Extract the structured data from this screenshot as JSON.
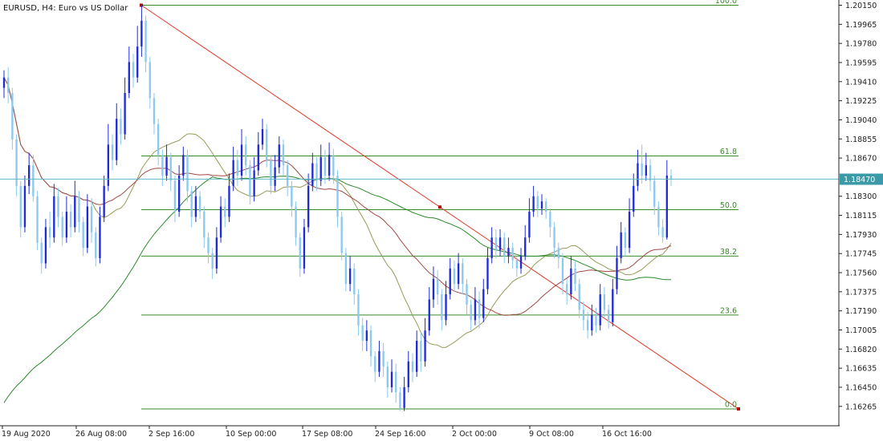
{
  "symbol_header": "EURUSD, H4:  Euro vs US Dollar",
  "current_price": "1.18470",
  "colors": {
    "background": "#ffffff",
    "bull_candle": "#1f2bd6",
    "bear_candle": "#8cc8f0",
    "fibo": "#3a8a2a",
    "trend_line": "#e03a2a",
    "ma_fast": "#9a9a56",
    "ma_mid": "#a04a44",
    "ma_slow": "#2a8a2a",
    "bid_line": "#5fb8c8",
    "axis": "#222222"
  },
  "price_axis": {
    "labels": [
      "1.20150",
      "1.19965",
      "1.19780",
      "1.19595",
      "1.19410",
      "1.19225",
      "1.19040",
      "1.18855",
      "1.18670",
      "1.18300",
      "1.18115",
      "1.17930",
      "1.17745",
      "1.17560",
      "1.17375",
      "1.17190",
      "1.17005",
      "1.16820",
      "1.16635",
      "1.16450",
      "1.16265"
    ]
  },
  "time_axis": {
    "labels": [
      "19 Aug 2020",
      "26 Aug 08:00",
      "2 Sep 16:00",
      "10 Sep 00:00",
      "17 Sep 08:00",
      "24 Sep 16:00",
      "2 Oct 00:00",
      "9 Oct 08:00",
      "16 Oct 16:00"
    ]
  },
  "fibonacci": {
    "levels": [
      {
        "label": "100.0",
        "price": 1.2015
      },
      {
        "label": "61.8",
        "price": 1.1869
      },
      {
        "label": "50.0",
        "price": 1.1817
      },
      {
        "label": "38.2",
        "price": 1.1772
      },
      {
        "label": "23.6",
        "price": 1.1715
      },
      {
        "label": "0.0",
        "price": 1.1624
      }
    ]
  },
  "chart_data": {
    "type": "candlestick",
    "symbol": "EURUSD",
    "timeframe": "H4",
    "ylim": [
      1.1621,
      1.2018
    ],
    "candles": [
      {
        "o": 1.1935,
        "c": 1.1945,
        "h": 1.1952,
        "l": 1.1925
      },
      {
        "o": 1.1945,
        "c": 1.193,
        "h": 1.1955,
        "l": 1.192
      },
      {
        "o": 1.193,
        "c": 1.1885,
        "h": 1.1935,
        "l": 1.1875
      },
      {
        "o": 1.1885,
        "c": 1.184,
        "h": 1.189,
        "l": 1.183
      },
      {
        "o": 1.184,
        "c": 1.18,
        "h": 1.1845,
        "l": 1.179
      },
      {
        "o": 1.18,
        "c": 1.184,
        "h": 1.185,
        "l": 1.1795
      },
      {
        "o": 1.184,
        "c": 1.186,
        "h": 1.1872,
        "l": 1.1832
      },
      {
        "o": 1.186,
        "c": 1.183,
        "h": 1.187,
        "l": 1.1825
      },
      {
        "o": 1.183,
        "c": 1.1785,
        "h": 1.1835,
        "l": 1.1778
      },
      {
        "o": 1.1785,
        "c": 1.1765,
        "h": 1.179,
        "l": 1.1755
      },
      {
        "o": 1.1765,
        "c": 1.18,
        "h": 1.1808,
        "l": 1.176
      },
      {
        "o": 1.18,
        "c": 1.179,
        "h": 1.1815,
        "l": 1.178
      },
      {
        "o": 1.179,
        "c": 1.183,
        "h": 1.1842,
        "l": 1.1785
      },
      {
        "o": 1.183,
        "c": 1.181,
        "h": 1.1838,
        "l": 1.18
      },
      {
        "o": 1.181,
        "c": 1.179,
        "h": 1.1815,
        "l": 1.1782
      },
      {
        "o": 1.179,
        "c": 1.1815,
        "h": 1.183,
        "l": 1.1785
      },
      {
        "o": 1.1815,
        "c": 1.18,
        "h": 1.1822,
        "l": 1.179
      },
      {
        "o": 1.18,
        "c": 1.183,
        "h": 1.1845,
        "l": 1.1795
      },
      {
        "o": 1.183,
        "c": 1.1805,
        "h": 1.1835,
        "l": 1.1795
      },
      {
        "o": 1.1805,
        "c": 1.178,
        "h": 1.181,
        "l": 1.1772
      },
      {
        "o": 1.178,
        "c": 1.182,
        "h": 1.1832,
        "l": 1.1775
      },
      {
        "o": 1.182,
        "c": 1.1795,
        "h": 1.1828,
        "l": 1.1785
      },
      {
        "o": 1.1795,
        "c": 1.177,
        "h": 1.18,
        "l": 1.1762
      },
      {
        "o": 1.177,
        "c": 1.181,
        "h": 1.182,
        "l": 1.1765
      },
      {
        "o": 1.181,
        "c": 1.184,
        "h": 1.185,
        "l": 1.1805
      },
      {
        "o": 1.184,
        "c": 1.188,
        "h": 1.19,
        "l": 1.1835
      },
      {
        "o": 1.188,
        "c": 1.1865,
        "h": 1.189,
        "l": 1.1855
      },
      {
        "o": 1.1865,
        "c": 1.1905,
        "h": 1.192,
        "l": 1.186
      },
      {
        "o": 1.1905,
        "c": 1.189,
        "h": 1.1915,
        "l": 1.188
      },
      {
        "o": 1.189,
        "c": 1.193,
        "h": 1.1945,
        "l": 1.1885
      },
      {
        "o": 1.193,
        "c": 1.196,
        "h": 1.1975,
        "l": 1.1925
      },
      {
        "o": 1.196,
        "c": 1.1945,
        "h": 1.1968,
        "l": 1.1935
      },
      {
        "o": 1.1945,
        "c": 1.1975,
        "h": 1.1995,
        "l": 1.194
      },
      {
        "o": 1.1975,
        "c": 1.2,
        "h": 1.2015,
        "l": 1.1965
      },
      {
        "o": 1.2,
        "c": 1.196,
        "h": 1.2005,
        "l": 1.195
      },
      {
        "o": 1.196,
        "c": 1.1925,
        "h": 1.1965,
        "l": 1.1915
      },
      {
        "o": 1.1925,
        "c": 1.19,
        "h": 1.193,
        "l": 1.189
      },
      {
        "o": 1.19,
        "c": 1.187,
        "h": 1.1905,
        "l": 1.186
      },
      {
        "o": 1.187,
        "c": 1.185,
        "h": 1.1875,
        "l": 1.184
      },
      {
        "o": 1.185,
        "c": 1.1868,
        "h": 1.188,
        "l": 1.1845
      },
      {
        "o": 1.1868,
        "c": 1.1845,
        "h": 1.1872,
        "l": 1.1835
      },
      {
        "o": 1.1845,
        "c": 1.1815,
        "h": 1.185,
        "l": 1.1805
      },
      {
        "o": 1.1815,
        "c": 1.185,
        "h": 1.186,
        "l": 1.181
      },
      {
        "o": 1.185,
        "c": 1.187,
        "h": 1.1878,
        "l": 1.1845
      },
      {
        "o": 1.187,
        "c": 1.1835,
        "h": 1.1875,
        "l": 1.1825
      },
      {
        "o": 1.1835,
        "c": 1.181,
        "h": 1.184,
        "l": 1.18
      },
      {
        "o": 1.181,
        "c": 1.183,
        "h": 1.184,
        "l": 1.1805
      },
      {
        "o": 1.183,
        "c": 1.1815,
        "h": 1.1835,
        "l": 1.1808
      },
      {
        "o": 1.1815,
        "c": 1.179,
        "h": 1.182,
        "l": 1.178
      },
      {
        "o": 1.179,
        "c": 1.1775,
        "h": 1.1795,
        "l": 1.1765
      },
      {
        "o": 1.1775,
        "c": 1.176,
        "h": 1.178,
        "l": 1.175
      },
      {
        "o": 1.176,
        "c": 1.179,
        "h": 1.18,
        "l": 1.1755
      },
      {
        "o": 1.179,
        "c": 1.182,
        "h": 1.183,
        "l": 1.1785
      },
      {
        "o": 1.182,
        "c": 1.181,
        "h": 1.1828,
        "l": 1.18
      },
      {
        "o": 1.181,
        "c": 1.184,
        "h": 1.1852,
        "l": 1.1805
      },
      {
        "o": 1.184,
        "c": 1.1865,
        "h": 1.1878,
        "l": 1.1835
      },
      {
        "o": 1.1865,
        "c": 1.185,
        "h": 1.1875,
        "l": 1.184
      },
      {
        "o": 1.185,
        "c": 1.188,
        "h": 1.1895,
        "l": 1.1845
      },
      {
        "o": 1.188,
        "c": 1.186,
        "h": 1.1888,
        "l": 1.185
      },
      {
        "o": 1.186,
        "c": 1.183,
        "h": 1.1865,
        "l": 1.1822
      },
      {
        "o": 1.183,
        "c": 1.1855,
        "h": 1.1868,
        "l": 1.1825
      },
      {
        "o": 1.1855,
        "c": 1.188,
        "h": 1.1892,
        "l": 1.185
      },
      {
        "o": 1.188,
        "c": 1.1895,
        "h": 1.1905,
        "l": 1.1875
      },
      {
        "o": 1.1895,
        "c": 1.1865,
        "h": 1.19,
        "l": 1.1858
      },
      {
        "o": 1.1865,
        "c": 1.184,
        "h": 1.187,
        "l": 1.1832
      },
      {
        "o": 1.184,
        "c": 1.1858,
        "h": 1.187,
        "l": 1.1835
      },
      {
        "o": 1.1858,
        "c": 1.188,
        "h": 1.1888,
        "l": 1.1852
      },
      {
        "o": 1.188,
        "c": 1.186,
        "h": 1.1885,
        "l": 1.185
      },
      {
        "o": 1.186,
        "c": 1.184,
        "h": 1.1865,
        "l": 1.183
      },
      {
        "o": 1.184,
        "c": 1.182,
        "h": 1.1845,
        "l": 1.181
      },
      {
        "o": 1.182,
        "c": 1.179,
        "h": 1.1825,
        "l": 1.1782
      },
      {
        "o": 1.179,
        "c": 1.176,
        "h": 1.1795,
        "l": 1.1752
      },
      {
        "o": 1.176,
        "c": 1.18,
        "h": 1.1808,
        "l": 1.1755
      },
      {
        "o": 1.18,
        "c": 1.184,
        "h": 1.1852,
        "l": 1.1795
      },
      {
        "o": 1.184,
        "c": 1.1862,
        "h": 1.1872,
        "l": 1.1835
      },
      {
        "o": 1.1862,
        "c": 1.1845,
        "h": 1.1868,
        "l": 1.1835
      },
      {
        "o": 1.1845,
        "c": 1.1868,
        "h": 1.188,
        "l": 1.184
      },
      {
        "o": 1.1868,
        "c": 1.185,
        "h": 1.1875,
        "l": 1.1842
      },
      {
        "o": 1.185,
        "c": 1.187,
        "h": 1.1882,
        "l": 1.1845
      },
      {
        "o": 1.187,
        "c": 1.185,
        "h": 1.1876,
        "l": 1.1842
      },
      {
        "o": 1.185,
        "c": 1.181,
        "h": 1.1855,
        "l": 1.18
      },
      {
        "o": 1.181,
        "c": 1.1775,
        "h": 1.1815,
        "l": 1.1768
      },
      {
        "o": 1.1775,
        "c": 1.1745,
        "h": 1.178,
        "l": 1.1738
      },
      {
        "o": 1.1745,
        "c": 1.176,
        "h": 1.1772,
        "l": 1.1738
      },
      {
        "o": 1.176,
        "c": 1.1735,
        "h": 1.1765,
        "l": 1.1725
      },
      {
        "o": 1.1735,
        "c": 1.1705,
        "h": 1.174,
        "l": 1.1695
      },
      {
        "o": 1.1705,
        "c": 1.169,
        "h": 1.1712,
        "l": 1.168
      },
      {
        "o": 1.169,
        "c": 1.17,
        "h": 1.171,
        "l": 1.168
      },
      {
        "o": 1.17,
        "c": 1.1675,
        "h": 1.1705,
        "l": 1.1665
      },
      {
        "o": 1.1675,
        "c": 1.166,
        "h": 1.168,
        "l": 1.165
      },
      {
        "o": 1.166,
        "c": 1.168,
        "h": 1.169,
        "l": 1.1655
      },
      {
        "o": 1.168,
        "c": 1.1665,
        "h": 1.1688,
        "l": 1.1655
      },
      {
        "o": 1.1665,
        "c": 1.1645,
        "h": 1.167,
        "l": 1.1635
      },
      {
        "o": 1.1645,
        "c": 1.166,
        "h": 1.1672,
        "l": 1.164
      },
      {
        "o": 1.166,
        "c": 1.164,
        "h": 1.1668,
        "l": 1.163
      },
      {
        "o": 1.164,
        "c": 1.1625,
        "h": 1.1645,
        "l": 1.1622
      },
      {
        "o": 1.1625,
        "c": 1.1645,
        "h": 1.1655,
        "l": 1.1622
      },
      {
        "o": 1.1645,
        "c": 1.167,
        "h": 1.168,
        "l": 1.164
      },
      {
        "o": 1.167,
        "c": 1.166,
        "h": 1.1678,
        "l": 1.165
      },
      {
        "o": 1.166,
        "c": 1.169,
        "h": 1.17,
        "l": 1.1655
      },
      {
        "o": 1.169,
        "c": 1.167,
        "h": 1.1698,
        "l": 1.166
      },
      {
        "o": 1.167,
        "c": 1.17,
        "h": 1.1712,
        "l": 1.1665
      },
      {
        "o": 1.17,
        "c": 1.173,
        "h": 1.1742,
        "l": 1.1695
      },
      {
        "o": 1.173,
        "c": 1.175,
        "h": 1.1762,
        "l": 1.1722
      },
      {
        "o": 1.175,
        "c": 1.1735,
        "h": 1.1758,
        "l": 1.1725
      },
      {
        "o": 1.1735,
        "c": 1.171,
        "h": 1.174,
        "l": 1.17
      },
      {
        "o": 1.171,
        "c": 1.1735,
        "h": 1.1748,
        "l": 1.1705
      },
      {
        "o": 1.1735,
        "c": 1.176,
        "h": 1.177,
        "l": 1.173
      },
      {
        "o": 1.176,
        "c": 1.1745,
        "h": 1.1768,
        "l": 1.1738
      },
      {
        "o": 1.1745,
        "c": 1.1765,
        "h": 1.1775,
        "l": 1.174
      },
      {
        "o": 1.1765,
        "c": 1.1745,
        "h": 1.177,
        "l": 1.1735
      },
      {
        "o": 1.1745,
        "c": 1.1725,
        "h": 1.175,
        "l": 1.1715
      },
      {
        "o": 1.1725,
        "c": 1.171,
        "h": 1.173,
        "l": 1.17
      },
      {
        "o": 1.171,
        "c": 1.173,
        "h": 1.1742,
        "l": 1.1705
      },
      {
        "o": 1.173,
        "c": 1.1712,
        "h": 1.1738,
        "l": 1.1702
      },
      {
        "o": 1.1712,
        "c": 1.174,
        "h": 1.175,
        "l": 1.1708
      },
      {
        "o": 1.174,
        "c": 1.177,
        "h": 1.178,
        "l": 1.1735
      },
      {
        "o": 1.177,
        "c": 1.179,
        "h": 1.18,
        "l": 1.1765
      },
      {
        "o": 1.179,
        "c": 1.1778,
        "h": 1.1798,
        "l": 1.177
      },
      {
        "o": 1.1778,
        "c": 1.179,
        "h": 1.1798,
        "l": 1.1772
      },
      {
        "o": 1.179,
        "c": 1.1772,
        "h": 1.1795,
        "l": 1.1765
      },
      {
        "o": 1.1772,
        "c": 1.178,
        "h": 1.179,
        "l": 1.1765
      },
      {
        "o": 1.178,
        "c": 1.1768,
        "h": 1.1785,
        "l": 1.176
      },
      {
        "o": 1.1768,
        "c": 1.176,
        "h": 1.1772,
        "l": 1.1752
      },
      {
        "o": 1.176,
        "c": 1.1772,
        "h": 1.178,
        "l": 1.1755
      },
      {
        "o": 1.1772,
        "c": 1.179,
        "h": 1.1802,
        "l": 1.1768
      },
      {
        "o": 1.179,
        "c": 1.1815,
        "h": 1.1828,
        "l": 1.1785
      },
      {
        "o": 1.1815,
        "c": 1.183,
        "h": 1.184,
        "l": 1.181
      },
      {
        "o": 1.183,
        "c": 1.1818,
        "h": 1.1835,
        "l": 1.181
      },
      {
        "o": 1.1818,
        "c": 1.1825,
        "h": 1.1832,
        "l": 1.1812
      },
      {
        "o": 1.1825,
        "c": 1.1815,
        "h": 1.1828,
        "l": 1.1808
      },
      {
        "o": 1.1815,
        "c": 1.18,
        "h": 1.1818,
        "l": 1.179
      },
      {
        "o": 1.18,
        "c": 1.178,
        "h": 1.1805,
        "l": 1.177
      },
      {
        "o": 1.178,
        "c": 1.177,
        "h": 1.1785,
        "l": 1.176
      },
      {
        "o": 1.177,
        "c": 1.1745,
        "h": 1.1775,
        "l": 1.1735
      },
      {
        "o": 1.1745,
        "c": 1.1735,
        "h": 1.175,
        "l": 1.1725
      },
      {
        "o": 1.1735,
        "c": 1.176,
        "h": 1.1772,
        "l": 1.173
      },
      {
        "o": 1.176,
        "c": 1.1745,
        "h": 1.1768,
        "l": 1.1738
      },
      {
        "o": 1.1745,
        "c": 1.172,
        "h": 1.175,
        "l": 1.1712
      },
      {
        "o": 1.172,
        "c": 1.171,
        "h": 1.1728,
        "l": 1.17
      },
      {
        "o": 1.171,
        "c": 1.17,
        "h": 1.1718,
        "l": 1.1692
      },
      {
        "o": 1.17,
        "c": 1.1715,
        "h": 1.1725,
        "l": 1.1695
      },
      {
        "o": 1.1715,
        "c": 1.1705,
        "h": 1.1722,
        "l": 1.1698
      },
      {
        "o": 1.1705,
        "c": 1.1735,
        "h": 1.1745,
        "l": 1.17
      },
      {
        "o": 1.1735,
        "c": 1.172,
        "h": 1.1742,
        "l": 1.1712
      },
      {
        "o": 1.172,
        "c": 1.1708,
        "h": 1.1725,
        "l": 1.1702
      },
      {
        "o": 1.1708,
        "c": 1.174,
        "h": 1.175,
        "l": 1.1704
      },
      {
        "o": 1.174,
        "c": 1.177,
        "h": 1.1782,
        "l": 1.1735
      },
      {
        "o": 1.177,
        "c": 1.1795,
        "h": 1.1805,
        "l": 1.1765
      },
      {
        "o": 1.1795,
        "c": 1.178,
        "h": 1.18,
        "l": 1.1772
      },
      {
        "o": 1.178,
        "c": 1.1815,
        "h": 1.1828,
        "l": 1.1775
      },
      {
        "o": 1.1815,
        "c": 1.184,
        "h": 1.1852,
        "l": 1.181
      },
      {
        "o": 1.184,
        "c": 1.1862,
        "h": 1.1875,
        "l": 1.1835
      },
      {
        "o": 1.1862,
        "c": 1.185,
        "h": 1.188,
        "l": 1.1842
      },
      {
        "o": 1.185,
        "c": 1.186,
        "h": 1.1872,
        "l": 1.1845
      },
      {
        "o": 1.186,
        "c": 1.1845,
        "h": 1.1866,
        "l": 1.1835
      },
      {
        "o": 1.1845,
        "c": 1.182,
        "h": 1.185,
        "l": 1.1812
      },
      {
        "o": 1.182,
        "c": 1.18,
        "h": 1.1825,
        "l": 1.1792
      },
      {
        "o": 1.18,
        "c": 1.179,
        "h": 1.1808,
        "l": 1.1785
      },
      {
        "o": 1.179,
        "c": 1.185,
        "h": 1.1865,
        "l": 1.1788
      },
      {
        "o": 1.185,
        "c": 1.1847,
        "h": 1.1856,
        "l": 1.184
      }
    ],
    "fib_levels": [
      100.0,
      61.8,
      50.0,
      38.2,
      23.6,
      0.0
    ],
    "x_tick_labels": [
      "19 Aug 2020",
      "26 Aug 08:00",
      "2 Sep 16:00",
      "10 Sep 00:00",
      "17 Sep 08:00",
      "24 Sep 16:00",
      "2 Oct 00:00",
      "9 Oct 08:00",
      "16 Oct 16:00"
    ],
    "grid": false
  }
}
